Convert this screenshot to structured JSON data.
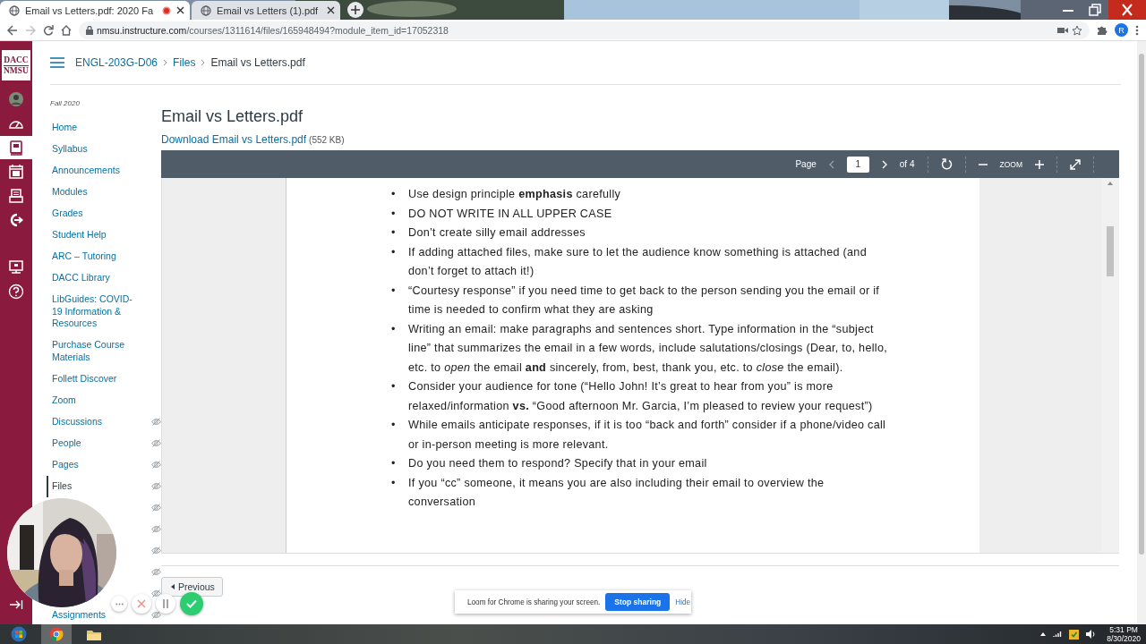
{
  "browser": {
    "tabs": [
      {
        "title": "Email vs Letters.pdf: 2020 Fa",
        "selected": true,
        "recording": true
      },
      {
        "title": "Email vs Letters (1).pdf",
        "selected": false,
        "recording": false
      }
    ],
    "url_host": "nmsu.instructure.com",
    "url_path": "/courses/1311614/files/165948494?module_item_id=17052318",
    "profile_initial": "R"
  },
  "global_nav": {
    "logo_top": "DACC",
    "logo_bottom": "NMSU",
    "items": [
      {
        "kind": "avatar",
        "selected": false
      },
      {
        "kind": "dashboard",
        "selected": false
      },
      {
        "kind": "courses",
        "selected": true
      },
      {
        "kind": "calendar",
        "selected": false
      },
      {
        "kind": "inbox",
        "selected": false
      },
      {
        "kind": "commons",
        "selected": false
      },
      {
        "kind": "studio",
        "selected": false
      },
      {
        "kind": "help",
        "selected": false
      }
    ]
  },
  "breadcrumb": [
    "ENGL-203G-D06",
    "Files",
    "Email vs Letters.pdf"
  ],
  "course_nav": {
    "term": "Fall 2020",
    "items": [
      {
        "label": "Home",
        "selected": false,
        "hidden": false
      },
      {
        "label": "Syllabus",
        "selected": false,
        "hidden": false
      },
      {
        "label": "Announcements",
        "selected": false,
        "hidden": false
      },
      {
        "label": "Modules",
        "selected": false,
        "hidden": false
      },
      {
        "label": "Grades",
        "selected": false,
        "hidden": false
      },
      {
        "label": "Student Help",
        "selected": false,
        "hidden": false
      },
      {
        "label": "ARC – Tutoring",
        "selected": false,
        "hidden": false
      },
      {
        "label": "DACC Library",
        "selected": false,
        "hidden": false
      },
      {
        "label": "LibGuides: COVID-19 Information & Resources",
        "selected": false,
        "hidden": false
      },
      {
        "label": "Purchase Course Materials",
        "selected": false,
        "hidden": false
      },
      {
        "label": "Follett Discover",
        "selected": false,
        "hidden": false
      },
      {
        "label": "Zoom",
        "selected": false,
        "hidden": false
      },
      {
        "label": "Discussions",
        "selected": false,
        "hidden": true
      },
      {
        "label": "People",
        "selected": false,
        "hidden": true
      },
      {
        "label": "Pages",
        "selected": false,
        "hidden": true
      },
      {
        "label": "Files",
        "selected": true,
        "hidden": true
      },
      {
        "hidden": true
      },
      {
        "hidden": true
      },
      {
        "hidden": true
      },
      {
        "hidden": true
      },
      {
        "hidden": true
      },
      {
        "label": "Assignments",
        "selected": false,
        "hidden": true
      }
    ]
  },
  "file": {
    "title": "Email vs Letters.pdf",
    "download_link": "Download Email vs Letters.pdf",
    "size": "(552 KB)"
  },
  "pdf_toolbar": {
    "page_label": "Page",
    "page": "1",
    "page_count": "of 4",
    "zoom_label": "ZOOM"
  },
  "pdf_bullets": [
    {
      "marker": "•",
      "text": "Use design principle **emphasis** carefully"
    },
    {
      "marker": "•",
      "text": "DO NOT WRITE IN ALL UPPER CASE"
    },
    {
      "marker": "•",
      "text": "Don’t create silly email addresses"
    },
    {
      "marker": "•",
      "text": "If adding attached files, make sure to let the audience know something is attached (and don’t forget to attach it!)"
    },
    {
      "marker": "•",
      "text": "“Courtesy response” if you need time to get back to the person sending you the email or if time is needed to confirm what they are asking"
    },
    {
      "marker": "•",
      "text": "Writing an email: make paragraphs and sentences short. Type information in the “subject line” that summarizes the email in a few words, include salutations/closings (Dear, to, hello, etc. to *open* the email **and** sincerely, from, best, thank you, etc. to *close* the email)."
    },
    {
      "marker": "•",
      "text": "Consider your audience for tone (“Hello John! It’s great to hear from you” is more relaxed/information **vs.** “Good afternoon Mr. Garcia, I’m pleased to review your request”)"
    },
    {
      "marker": "•",
      "text": "While emails anticipate responses, if it is too “back and forth” consider if a phone/video call or in-person meeting is more relevant."
    },
    {
      "marker": "•",
      "text": "Do you need them to respond? Specify that in your email"
    },
    {
      "marker": "•",
      "text": "If you “cc” someone, it means you are also including their email to overview the conversation"
    }
  ],
  "previous_button": "Previous",
  "loom": {
    "message": "Loom for Chrome is sharing your screen.",
    "stop": "Stop sharing",
    "hide": "Hide"
  },
  "taskbar": {
    "time": "5:31 PM",
    "date": "8/30/2020"
  }
}
